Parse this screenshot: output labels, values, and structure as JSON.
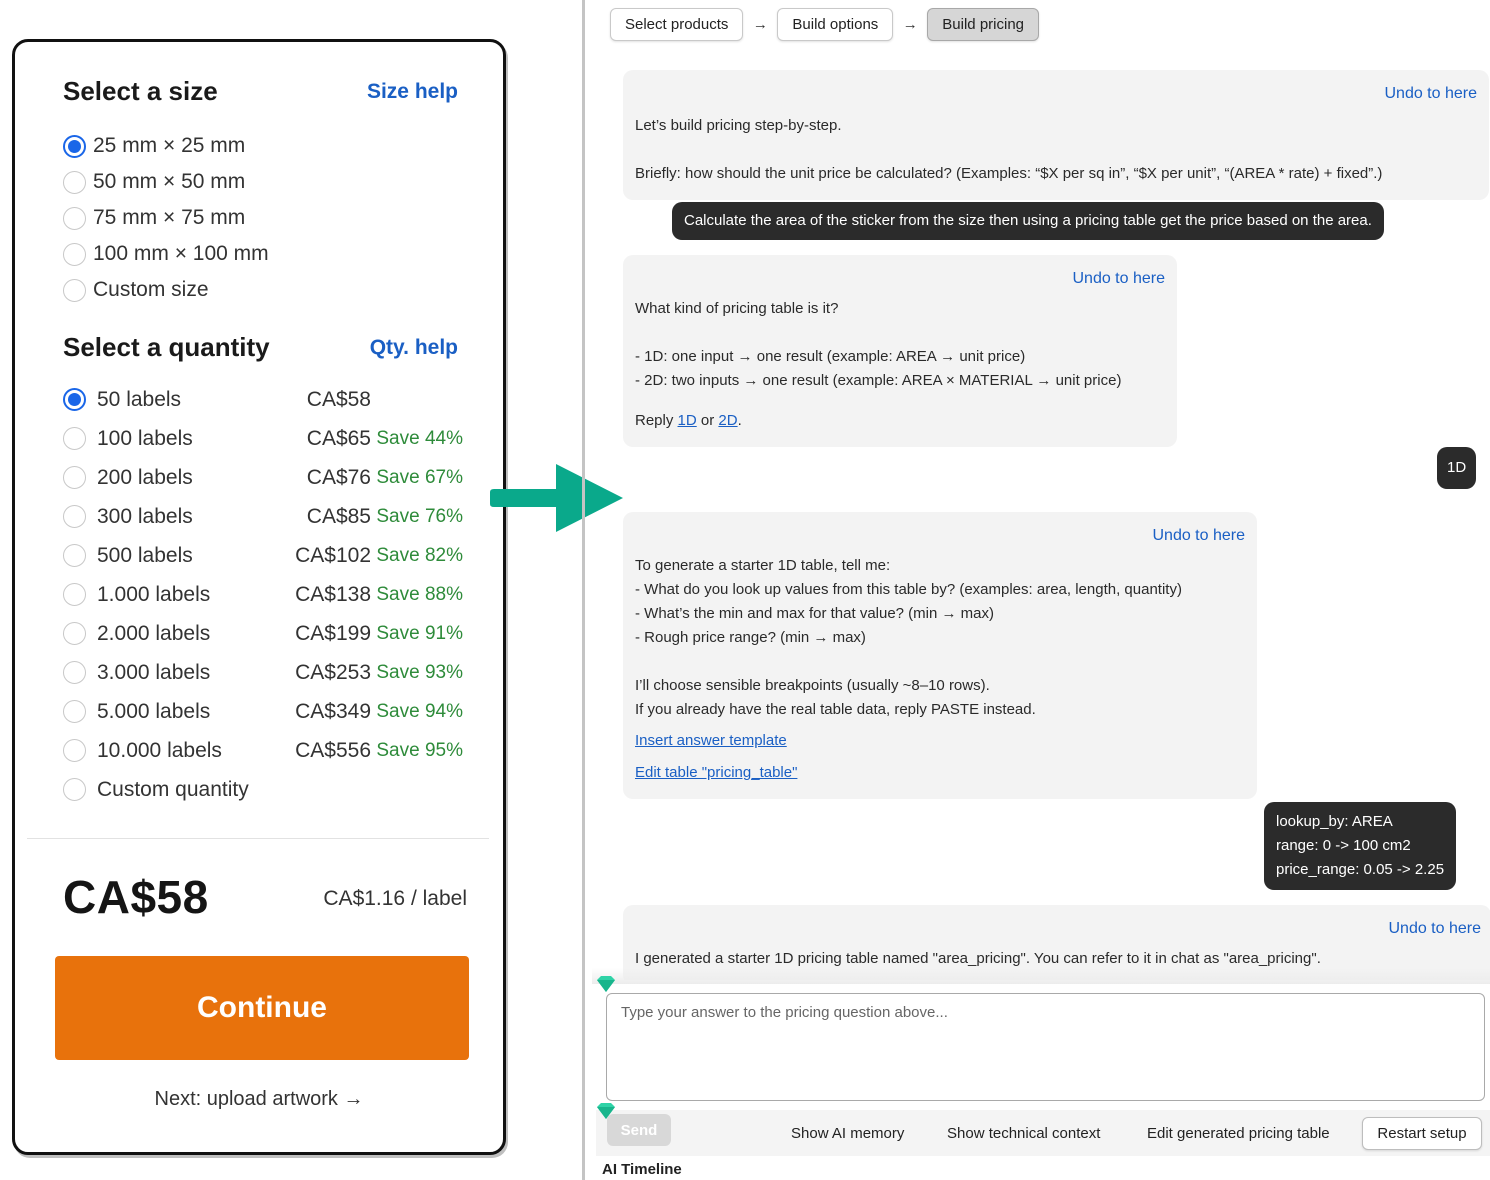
{
  "product": {
    "size_title": "Select a size",
    "size_help": "Size help",
    "sizes": [
      {
        "label": "25 mm × 25 mm",
        "selected": true
      },
      {
        "label": "50 mm × 50 mm",
        "selected": false
      },
      {
        "label": "75 mm × 75 mm",
        "selected": false
      },
      {
        "label": "100 mm × 100 mm",
        "selected": false
      },
      {
        "label": "Custom size",
        "selected": false
      }
    ],
    "qty_title": "Select a quantity",
    "qty_help": "Qty. help",
    "quantities": [
      {
        "label": "50 labels",
        "price": "CA$58",
        "save": "",
        "selected": true
      },
      {
        "label": "100 labels",
        "price": "CA$65",
        "save": "Save 44%",
        "selected": false
      },
      {
        "label": "200 labels",
        "price": "CA$76",
        "save": "Save 67%",
        "selected": false
      },
      {
        "label": "300 labels",
        "price": "CA$85",
        "save": "Save 76%",
        "selected": false
      },
      {
        "label": "500 labels",
        "price": "CA$102",
        "save": "Save 82%",
        "selected": false
      },
      {
        "label": "1.000 labels",
        "price": "CA$138",
        "save": "Save 88%",
        "selected": false
      },
      {
        "label": "2.000 labels",
        "price": "CA$199",
        "save": "Save 91%",
        "selected": false
      },
      {
        "label": "3.000 labels",
        "price": "CA$253",
        "save": "Save 93%",
        "selected": false
      },
      {
        "label": "5.000 labels",
        "price": "CA$349",
        "save": "Save 94%",
        "selected": false
      },
      {
        "label": "10.000 labels",
        "price": "CA$556",
        "save": "Save 95%",
        "selected": false
      },
      {
        "label": "Custom quantity",
        "price": "",
        "save": "",
        "selected": false
      }
    ],
    "total_price": "CA$58",
    "per_label": "CA$1.16 / label",
    "continue_label": "Continue",
    "next_step": "Next: upload artwork →"
  },
  "colors": {
    "accent_orange": "#e8720c",
    "link_blue": "#1a5fc4",
    "radio_blue": "#1a66e8",
    "save_green": "#2e8b3a",
    "arrow_teal": "#0aa98b",
    "user_bubble": "#2b2b2b"
  },
  "icons": {
    "arrow": "right-arrow-icon",
    "gem": "gem-icon"
  },
  "wizard": {
    "steps": [
      {
        "label": "Select products",
        "active": false
      },
      {
        "label": "Build options",
        "active": false
      },
      {
        "label": "Build pricing",
        "active": true
      }
    ],
    "separator": "→"
  },
  "chat": {
    "undo_label": "Undo to here",
    "msg1": {
      "line1": "Let’s build pricing step-by-step.",
      "line2": "Briefly: how should the unit price be calculated? (Examples: “$X per sq in”, “$X per unit”,  “(AREA * rate) + fixed”.)"
    },
    "user1": "Calculate the area of the sticker from the size then using a pricing table get the price based on the area.",
    "msg2": {
      "question": "What kind of pricing table is it?",
      "option1": "- 1D: one input → one result (example: AREA → unit price)",
      "option2": "- 2D: two inputs → one result (example: AREA × MATERIAL → unit price)",
      "reply_prefix": "Reply",
      "reply_1d": "1D",
      "reply_or": "or",
      "reply_2d": "2D",
      "reply_suffix": "."
    },
    "user2": "1D",
    "msg3": {
      "intro": "To generate a starter 1D table, tell me:",
      "q1": "- What do you look up values from this table by? (examples: area, length, quantity)",
      "q2": "- What’s the min and max for that value? (min → max)",
      "q3": "- Rough price range? (min → max)",
      "note1": "I’ll choose sensible breakpoints (usually ~8–10 rows).",
      "note2": "If you already have the real table data, reply PASTE instead.",
      "link1": "Insert answer template",
      "link2": "Edit table \"pricing_table\""
    },
    "user3": {
      "line1": "lookup_by: AREA",
      "line2": "range: 0 -> 100 cm2",
      "line3": "price_range: 0.05 -> 2.25"
    },
    "msg4": "I generated a starter 1D pricing table named \"area_pricing\". You can refer to it in chat as \"area_pricing\"."
  },
  "composer": {
    "placeholder": "Type your answer to the pricing question above...",
    "send_label": "Send",
    "show_memory": "Show AI memory",
    "show_context": "Show technical context",
    "edit_table": "Edit generated pricing table",
    "restart": "Restart setup",
    "timeline": "AI Timeline"
  }
}
